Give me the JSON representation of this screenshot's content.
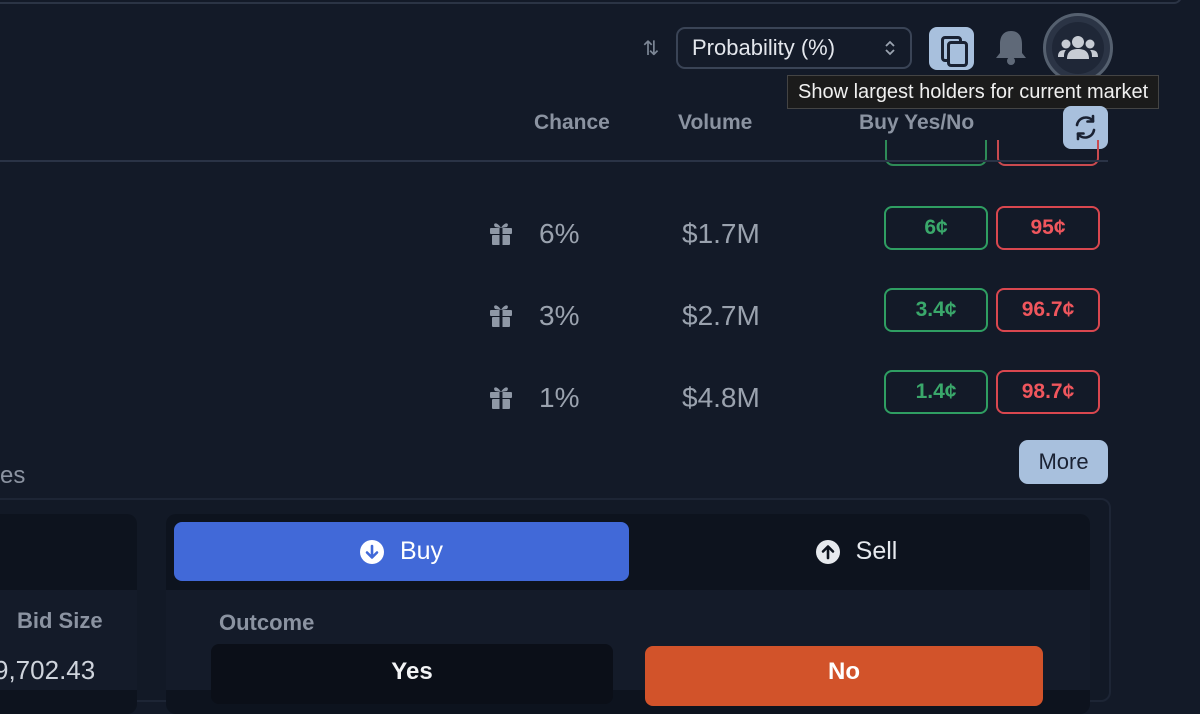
{
  "toolbar": {
    "sort_icon": "sort-arrows-icon",
    "sort_select_value": "Probability (%)",
    "copy_icon": "copy-icon",
    "bell_icon": "bell-icon",
    "holders_icon": "users-group-icon",
    "tooltip": "Show largest holders for current market"
  },
  "table": {
    "headers": {
      "chance": "Chance",
      "volume": "Volume",
      "buy": "Buy Yes/No"
    },
    "refresh_icon": "refresh-icon",
    "rows": [
      {
        "chance": "6%",
        "volume": "$1.7M",
        "yes": "6¢",
        "no": "95¢"
      },
      {
        "chance": "3%",
        "volume": "$2.7M",
        "yes": "3.4¢",
        "no": "96.7¢"
      },
      {
        "chance": "1%",
        "volume": "$4.8M",
        "yes": "1.4¢",
        "no": "98.7¢"
      }
    ],
    "more_label": "More"
  },
  "section_fragment": "es",
  "orderbook": {
    "bid_size_header": "Bid Size",
    "bid_size_value": "9,702.43"
  },
  "trade": {
    "buy_label": "Buy",
    "sell_label": "Sell",
    "outcome_label": "Outcome",
    "yes_label": "Yes",
    "no_label": "No"
  },
  "colors": {
    "background": "#131a28",
    "accent_blue": "#4169d8",
    "yes_green": "#3aa86b",
    "no_red": "#f0565d",
    "no_orange": "#d2532a",
    "button_light": "#a8c0dd"
  }
}
